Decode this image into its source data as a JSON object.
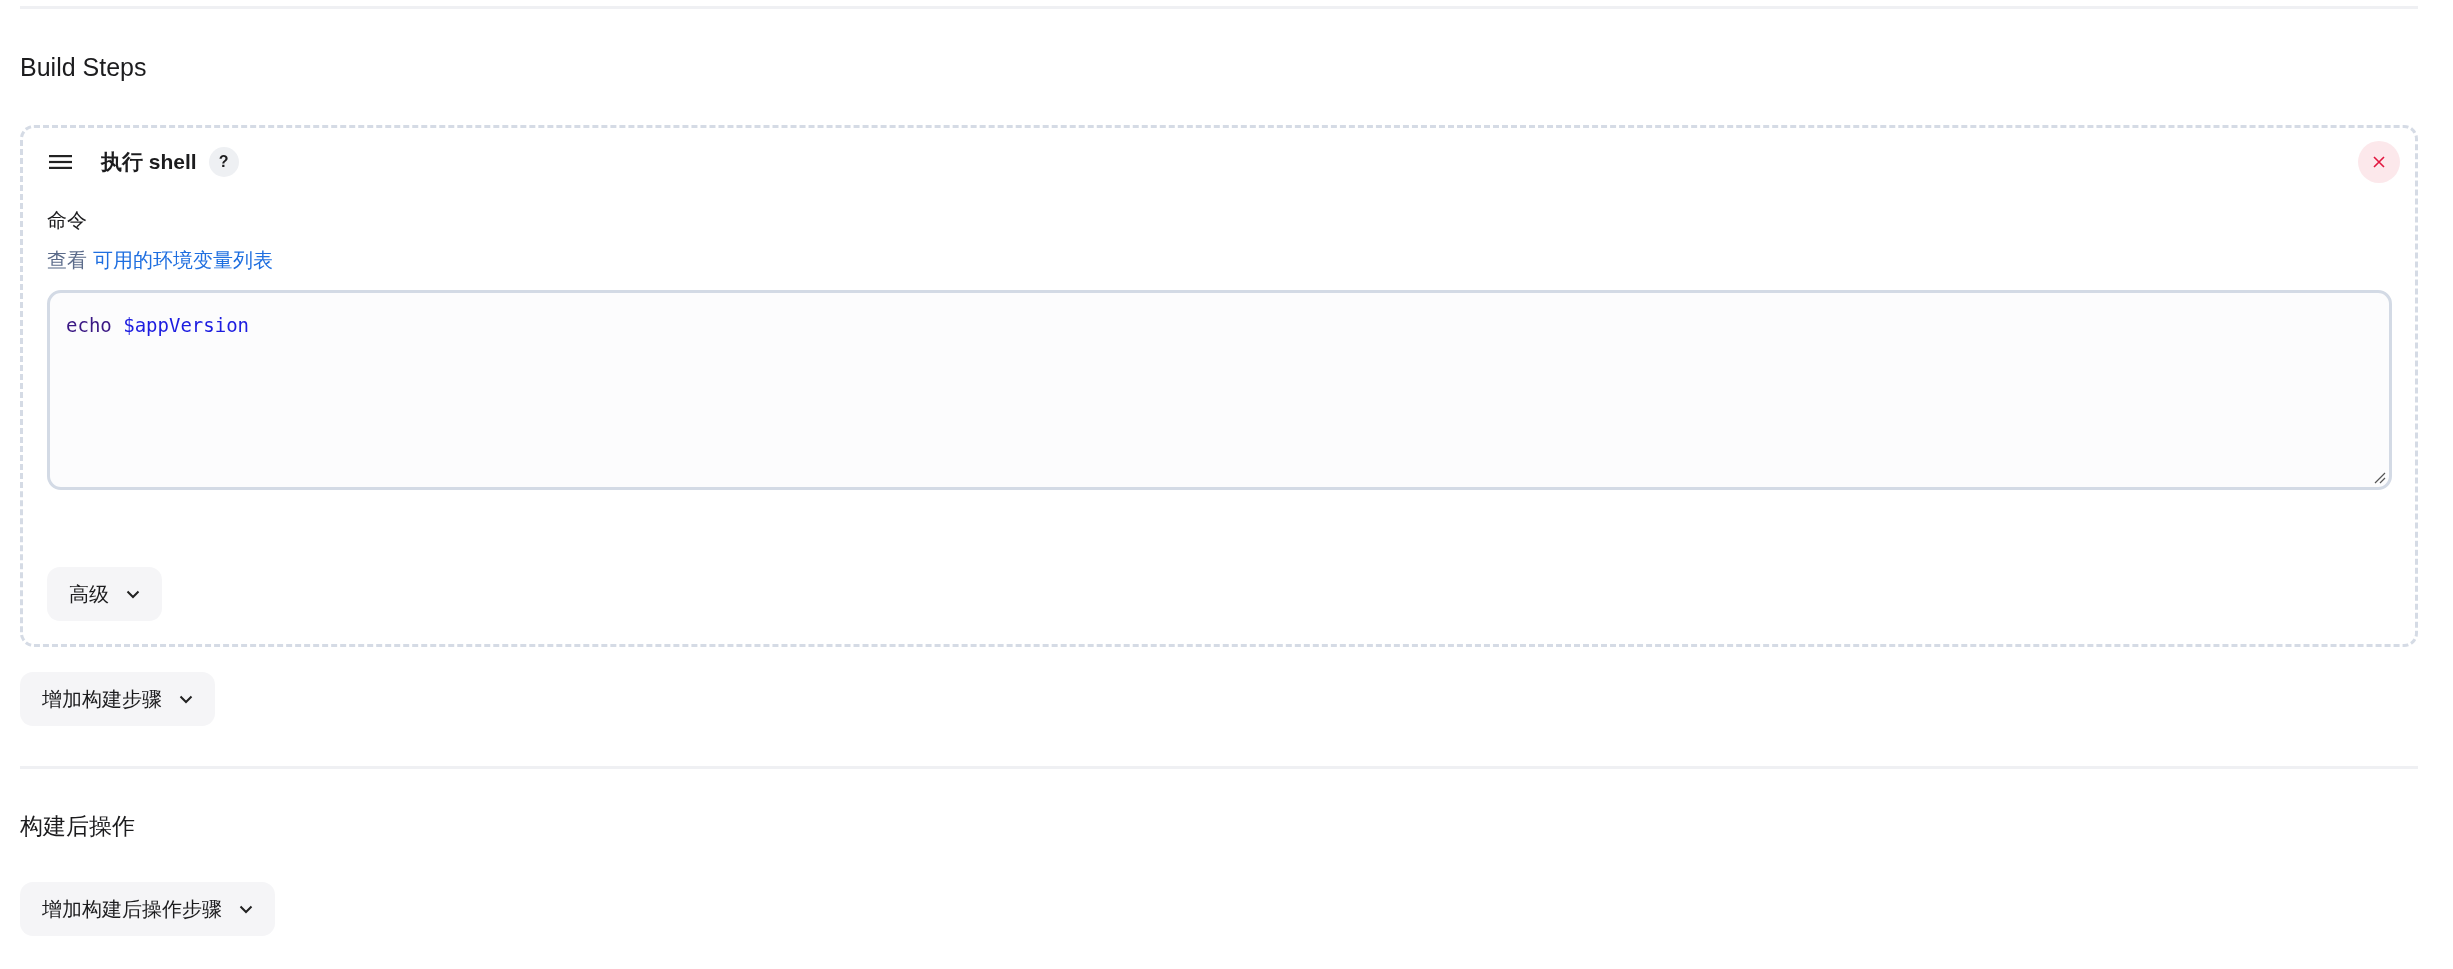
{
  "build_steps": {
    "title": "Build Steps",
    "steps": [
      {
        "title": "执行 shell",
        "help_label": "?",
        "field_label": "命令",
        "hint_prefix": "查看",
        "hint_link": "可用的环境变量列表",
        "command": [
          {
            "text": "echo",
            "kind": "keyword"
          },
          {
            "text": "$appVersion",
            "kind": "variable"
          }
        ],
        "advanced_button": "高级"
      }
    ],
    "add_button": "增加构建步骤"
  },
  "post_build": {
    "title": "构建后操作",
    "add_button": "增加构建后操作步骤"
  }
}
